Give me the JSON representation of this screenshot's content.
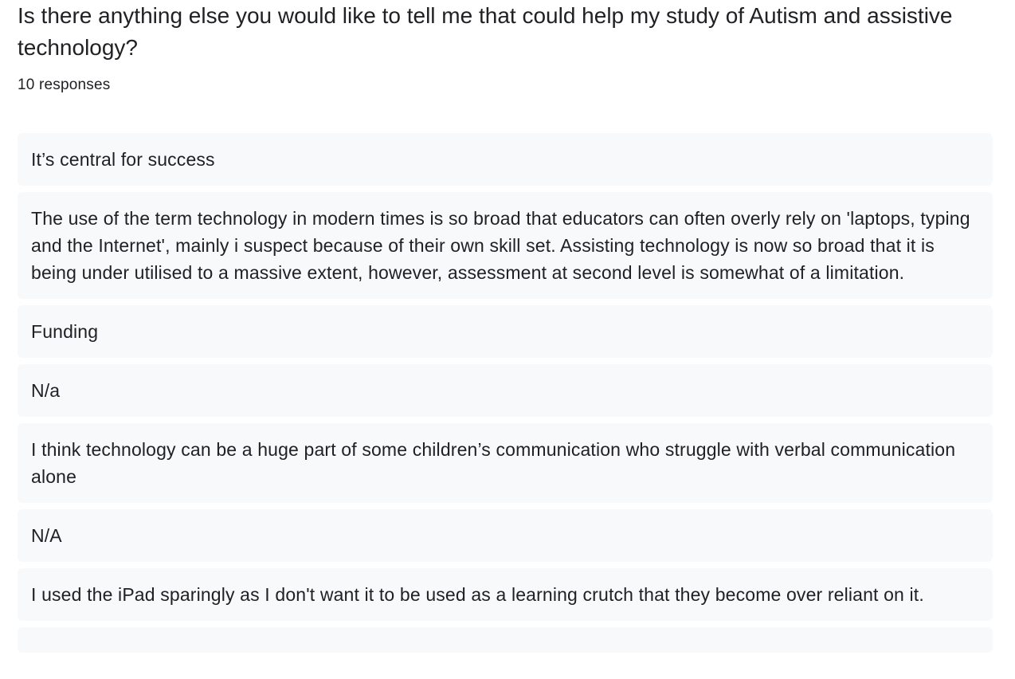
{
  "question": {
    "title": "Is there anything else you would like to tell me that could help my study of Autism and assistive technology?",
    "response_count": "10 responses"
  },
  "responses": [
    "It’s central for success",
    "The use of the term technology in modern times is so broad that educators can often overly rely on 'laptops, typing and the Internet', mainly i suspect because of their own skill set. Assisting technology is now so broad that it is being under utilised to a massive extent, however, assessment at second level is somewhat of a limitation.",
    "Funding",
    "N/a",
    "I think technology can be a huge part of some children’s communication who struggle with verbal communication alone",
    "N/A",
    "I used the iPad sparingly as I don't want it to be used as a learning crutch that they become over reliant on it.",
    ""
  ]
}
